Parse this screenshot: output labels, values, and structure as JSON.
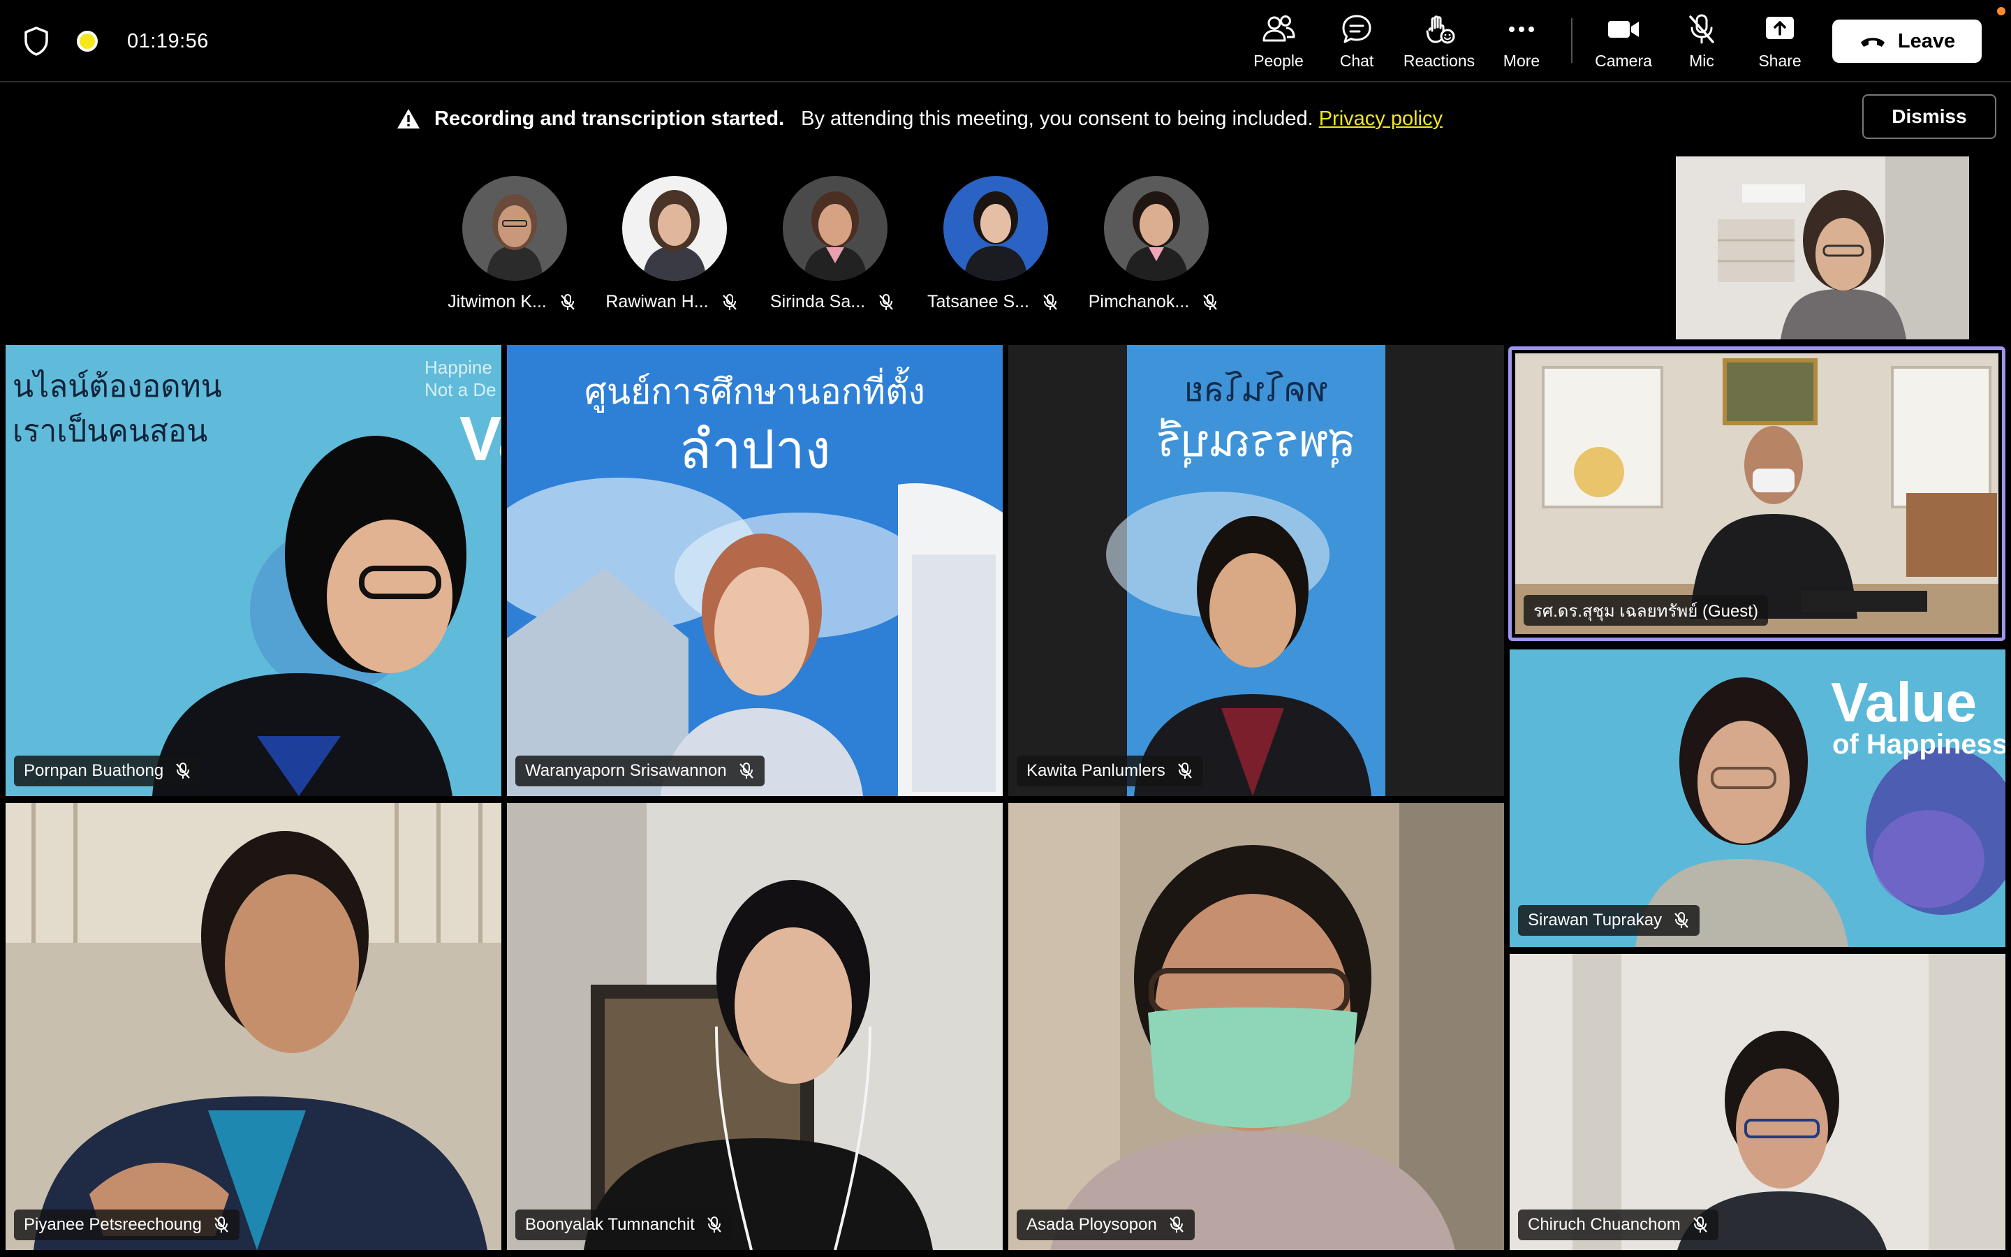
{
  "toolbar": {
    "timer": "01:19:56",
    "people_label": "People",
    "chat_label": "Chat",
    "reactions_label": "Reactions",
    "more_label": "More",
    "camera_label": "Camera",
    "mic_label": "Mic",
    "share_label": "Share",
    "leave_label": "Leave"
  },
  "banner": {
    "title": "Recording and transcription started.",
    "message": "By attending this meeting, you consent to being included.",
    "link": "Privacy policy",
    "dismiss_label": "Dismiss"
  },
  "audio_strip": [
    {
      "name": "Jitwimon K..."
    },
    {
      "name": "Rawiwan H..."
    },
    {
      "name": "Sirinda Sa..."
    },
    {
      "name": "Tatsanee S..."
    },
    {
      "name": "Pimchanok..."
    }
  ],
  "tiles": {
    "pornpan": {
      "name": "Pornpan Buathong",
      "bg_text_1": "นไลน์ต้องอดทน",
      "bg_text_2": "เราเป็นคนสอน",
      "bg_corner_1": "Happine",
      "bg_corner_2": "Not a De",
      "bg_big": "Va"
    },
    "waranyaporn": {
      "name": "Waranyaporn Srisawannon",
      "bg_text_1": "ศูนย์การศึกษานอกที่ตั้ง",
      "bg_text_2": "ลำปาง"
    },
    "kawita": {
      "name": "Kawita Panlumlers",
      "bg_text_1": "ทคโนโลย",
      "bg_text_2": "สุพรรณบุรี"
    },
    "guest": {
      "name": "รศ.ดร.สุชุม เฉลยทรัพย์ (Guest)"
    },
    "sirawan": {
      "name": "Sirawan Tuprakay",
      "bg_text_1": "Value",
      "bg_text_2": "of Happiness"
    },
    "piyanee": {
      "name": "Piyanee Petsreechoung"
    },
    "boonyalak": {
      "name": "Boonyalak Tumnanchit"
    },
    "asada": {
      "name": "Asada Ploysopon"
    },
    "chiruch": {
      "name": "Chiruch Chuanchom"
    }
  },
  "colors": {
    "accent_border": "#9d95ee",
    "recording_dot": "#f6e81a",
    "privacy_link": "#f4e61c"
  },
  "icons": [
    "shield-icon",
    "recording-icon",
    "people-icon",
    "chat-icon",
    "reactions-icon",
    "more-icon",
    "camera-icon",
    "mic-off-icon",
    "share-icon",
    "phone-icon",
    "warning-icon"
  ]
}
